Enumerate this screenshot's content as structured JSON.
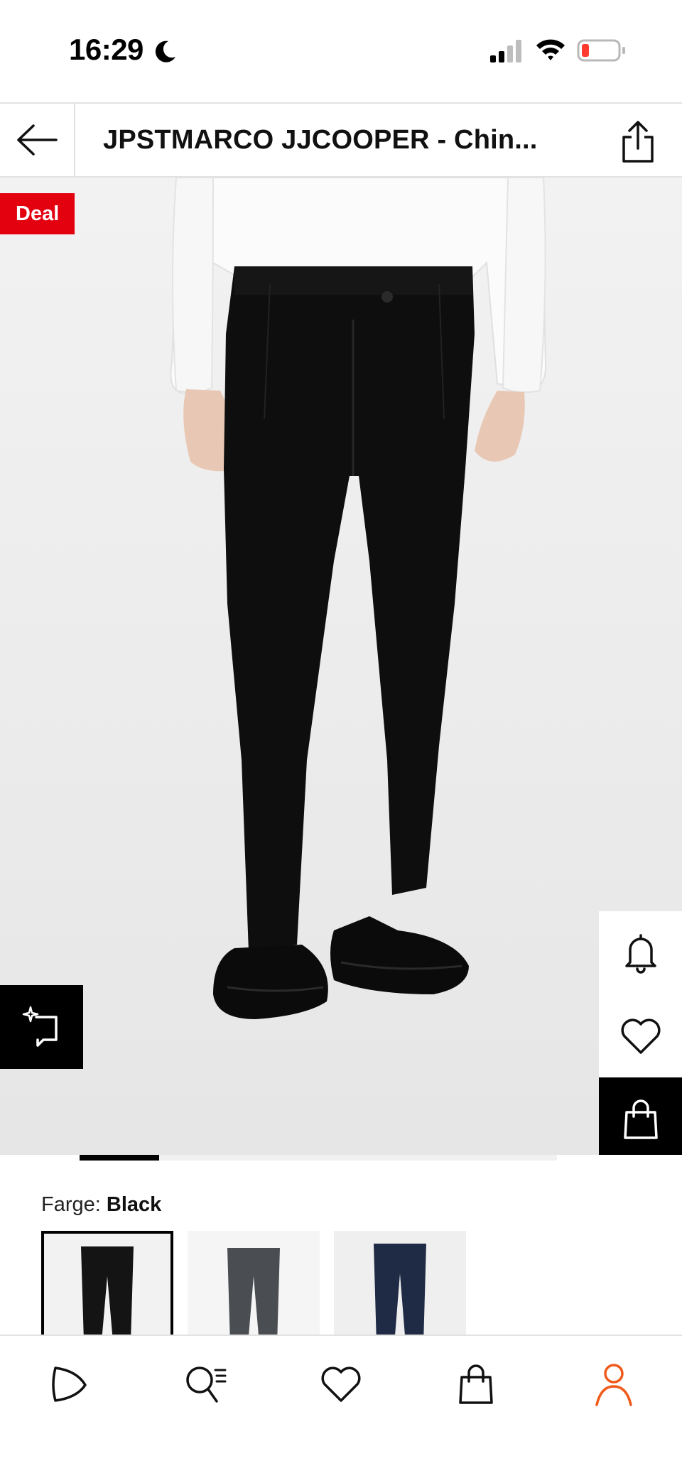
{
  "status_bar": {
    "time": "16:29",
    "icons": [
      "moon-icon",
      "signal-icon",
      "wifi-icon",
      "battery-icon"
    ],
    "battery_color": "#ff3b30"
  },
  "header": {
    "title": "JPSTMARCO JJCOOPER  - Chin...",
    "back_icon": "arrow-left-icon",
    "share_icon": "share-icon"
  },
  "product": {
    "badge": "Deal",
    "badge_color": "#e3000f",
    "image_alt": "Black slim chinos on model with white sweater and black loafers",
    "image_index": 1,
    "image_count": 6
  },
  "side_actions": {
    "icons": [
      "bell-icon",
      "heart-icon",
      "shopping-bag-icon"
    ]
  },
  "compare": {
    "icon": "compare-sparkle-icon"
  },
  "color": {
    "label": "Farge:",
    "selected": "Black",
    "swatches": [
      {
        "name": "Black",
        "color": "#141414"
      },
      {
        "name": "Grey",
        "color": "#4a4d52"
      },
      {
        "name": "Navy",
        "color": "#1f2a44"
      }
    ]
  },
  "bottom_nav": {
    "items": [
      {
        "name": "home",
        "icon": "play-logo-icon"
      },
      {
        "name": "search",
        "icon": "search-list-icon"
      },
      {
        "name": "wishlist",
        "icon": "heart-icon"
      },
      {
        "name": "cart",
        "icon": "shopping-bag-icon"
      },
      {
        "name": "profile",
        "icon": "user-icon",
        "active_color": "#f05a1a"
      }
    ]
  }
}
